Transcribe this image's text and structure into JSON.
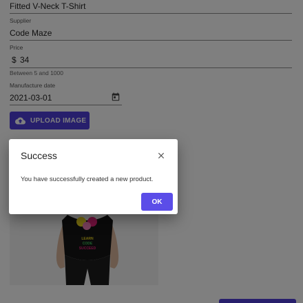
{
  "form": {
    "product_name_value": "Fitted V-Neck T-Shirt",
    "supplier_label": "Supplier",
    "supplier_value": "Code Maze",
    "price_label": "Price",
    "price_prefix": "$",
    "price_value": "34",
    "price_helper": "Between 5 and 1000",
    "date_label": "Manufacture date",
    "date_value": "2021-03-01",
    "upload_label": "UPLOAD IMAGE"
  },
  "product_image": {
    "shirt_text_line1": "LEARN",
    "shirt_text_line2": "CODE",
    "shirt_text_line3": "SUCCEED"
  },
  "dialog": {
    "title": "Success",
    "message": "You have successfully created a new product.",
    "ok_label": "OK"
  },
  "icons": {
    "upload": "cloud-upload-icon",
    "calendar": "calendar-icon",
    "close": "close-icon"
  },
  "colors": {
    "primary": "#4e3fd8",
    "overlay": "rgba(0,0,0,0.5)"
  }
}
